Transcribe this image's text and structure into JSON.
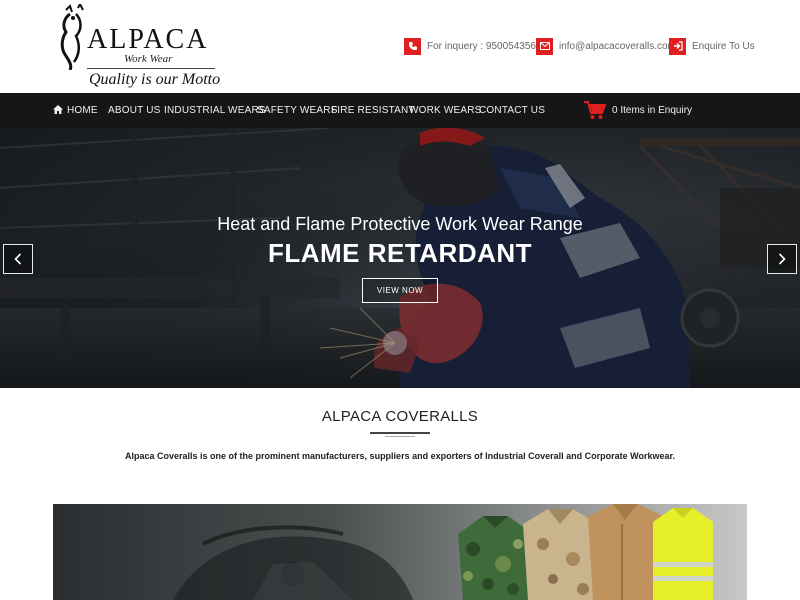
{
  "brand": {
    "name": "ALPACA",
    "sub": "Work Wear",
    "motto": "Quality is our Motto"
  },
  "contact": {
    "phone": "For inquery : 9500543562",
    "email": "info@alpacacoveralls.com",
    "enquire": "Enquire To Us"
  },
  "nav": {
    "items": [
      {
        "label": "HOME"
      },
      {
        "label": "ABOUT US"
      },
      {
        "label": "INDUSTRIAL WEARS"
      },
      {
        "label": "SAFETY WEARS"
      },
      {
        "label": "FIRE RESISTANT"
      },
      {
        "label": "WORK WEARS"
      },
      {
        "label": "CONTACT US"
      }
    ],
    "cart": "0 Items in Enquiry"
  },
  "hero": {
    "subtitle": "Heat and Flame Protective Work Wear Range",
    "title": "FLAME RETARDANT",
    "button": "VIEW NOW"
  },
  "about": {
    "title": "ALPACA COVERALLS",
    "text": "Alpaca Coveralls is one of the prominent manufacturers, suppliers and exporters of Industrial Coverall and Corporate Workwear."
  },
  "colors": {
    "accent": "#e02020",
    "nav_bg": "#161616"
  }
}
